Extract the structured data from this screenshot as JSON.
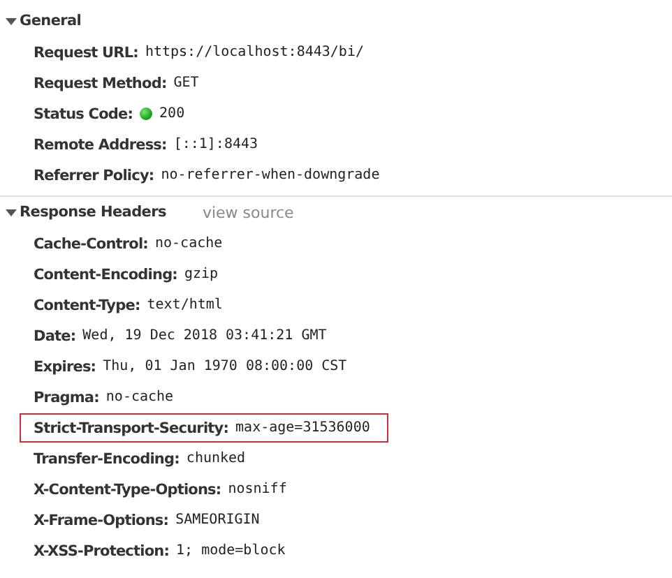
{
  "sections": [
    {
      "title": "General",
      "expanded": true,
      "rows": [
        {
          "name": "Request URL:",
          "value": "https://localhost:8443/bi/",
          "kind": "plain",
          "highlighted": false
        },
        {
          "name": "Request Method:",
          "value": "GET",
          "kind": "plain",
          "highlighted": false
        },
        {
          "name": "Status Code:",
          "value": "200",
          "kind": "status",
          "highlighted": false
        },
        {
          "name": "Remote Address:",
          "value": "[::1]:8443",
          "kind": "plain",
          "highlighted": false
        },
        {
          "name": "Referrer Policy:",
          "value": "no-referrer-when-downgrade",
          "kind": "plain",
          "highlighted": false
        }
      ]
    },
    {
      "title": "Response Headers",
      "expanded": true,
      "link": "view source",
      "rows": [
        {
          "name": "Cache-Control:",
          "value": "no-cache",
          "kind": "plain",
          "highlighted": false
        },
        {
          "name": "Content-Encoding:",
          "value": "gzip",
          "kind": "plain",
          "highlighted": false
        },
        {
          "name": "Content-Type:",
          "value": "text/html",
          "kind": "plain",
          "highlighted": false
        },
        {
          "name": "Date:",
          "value": "Wed, 19 Dec 2018 03:41:21 GMT",
          "kind": "plain",
          "highlighted": false
        },
        {
          "name": "Expires:",
          "value": "Thu, 01 Jan 1970 08:00:00 CST",
          "kind": "plain",
          "highlighted": false
        },
        {
          "name": "Pragma:",
          "value": "no-cache",
          "kind": "plain",
          "highlighted": false
        },
        {
          "name": "Strict-Transport-Security:",
          "value": "max-age=31536000",
          "kind": "plain",
          "highlighted": true
        },
        {
          "name": "Transfer-Encoding:",
          "value": "chunked",
          "kind": "plain",
          "highlighted": false
        },
        {
          "name": "X-Content-Type-Options:",
          "value": "nosniff",
          "kind": "plain",
          "highlighted": false
        },
        {
          "name": "X-Frame-Options:",
          "value": "SAMEORIGIN",
          "kind": "plain",
          "highlighted": false
        },
        {
          "name": "X-XSS-Protection:",
          "value": "1; mode=block",
          "kind": "plain",
          "highlighted": false
        }
      ]
    }
  ]
}
